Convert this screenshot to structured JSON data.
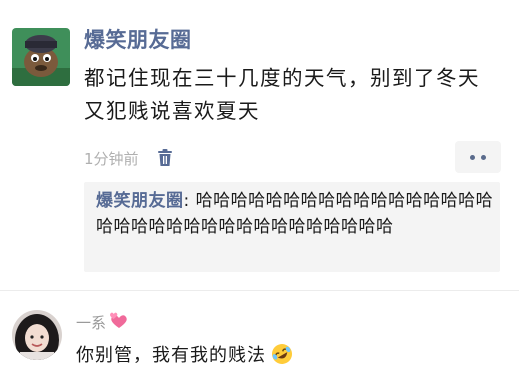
{
  "post": {
    "author": "爆笑朋友圈",
    "content": "都记住现在三十几度的天气，别到了冬天又犯贱说喜欢夏天",
    "time": "1分钟前",
    "icons": {
      "delete": "trash-icon",
      "more": "more-dots-icon"
    },
    "comment": {
      "author": "爆笑朋友圈",
      "separator": ": ",
      "text": "哈哈哈哈哈哈哈哈哈哈哈哈哈哈哈哈哈哈哈哈哈哈哈哈哈哈哈哈哈哈哈哈哈哈"
    }
  },
  "reply": {
    "name": "一系",
    "name_emoji": "two-hearts-icon",
    "text": "你别管，我有我的贱法",
    "text_emoji": "rolling-on-floor-laughing-icon"
  },
  "colors": {
    "link": "#576b95",
    "panel": "#f4f4f4",
    "meta": "#b0b0b0"
  }
}
